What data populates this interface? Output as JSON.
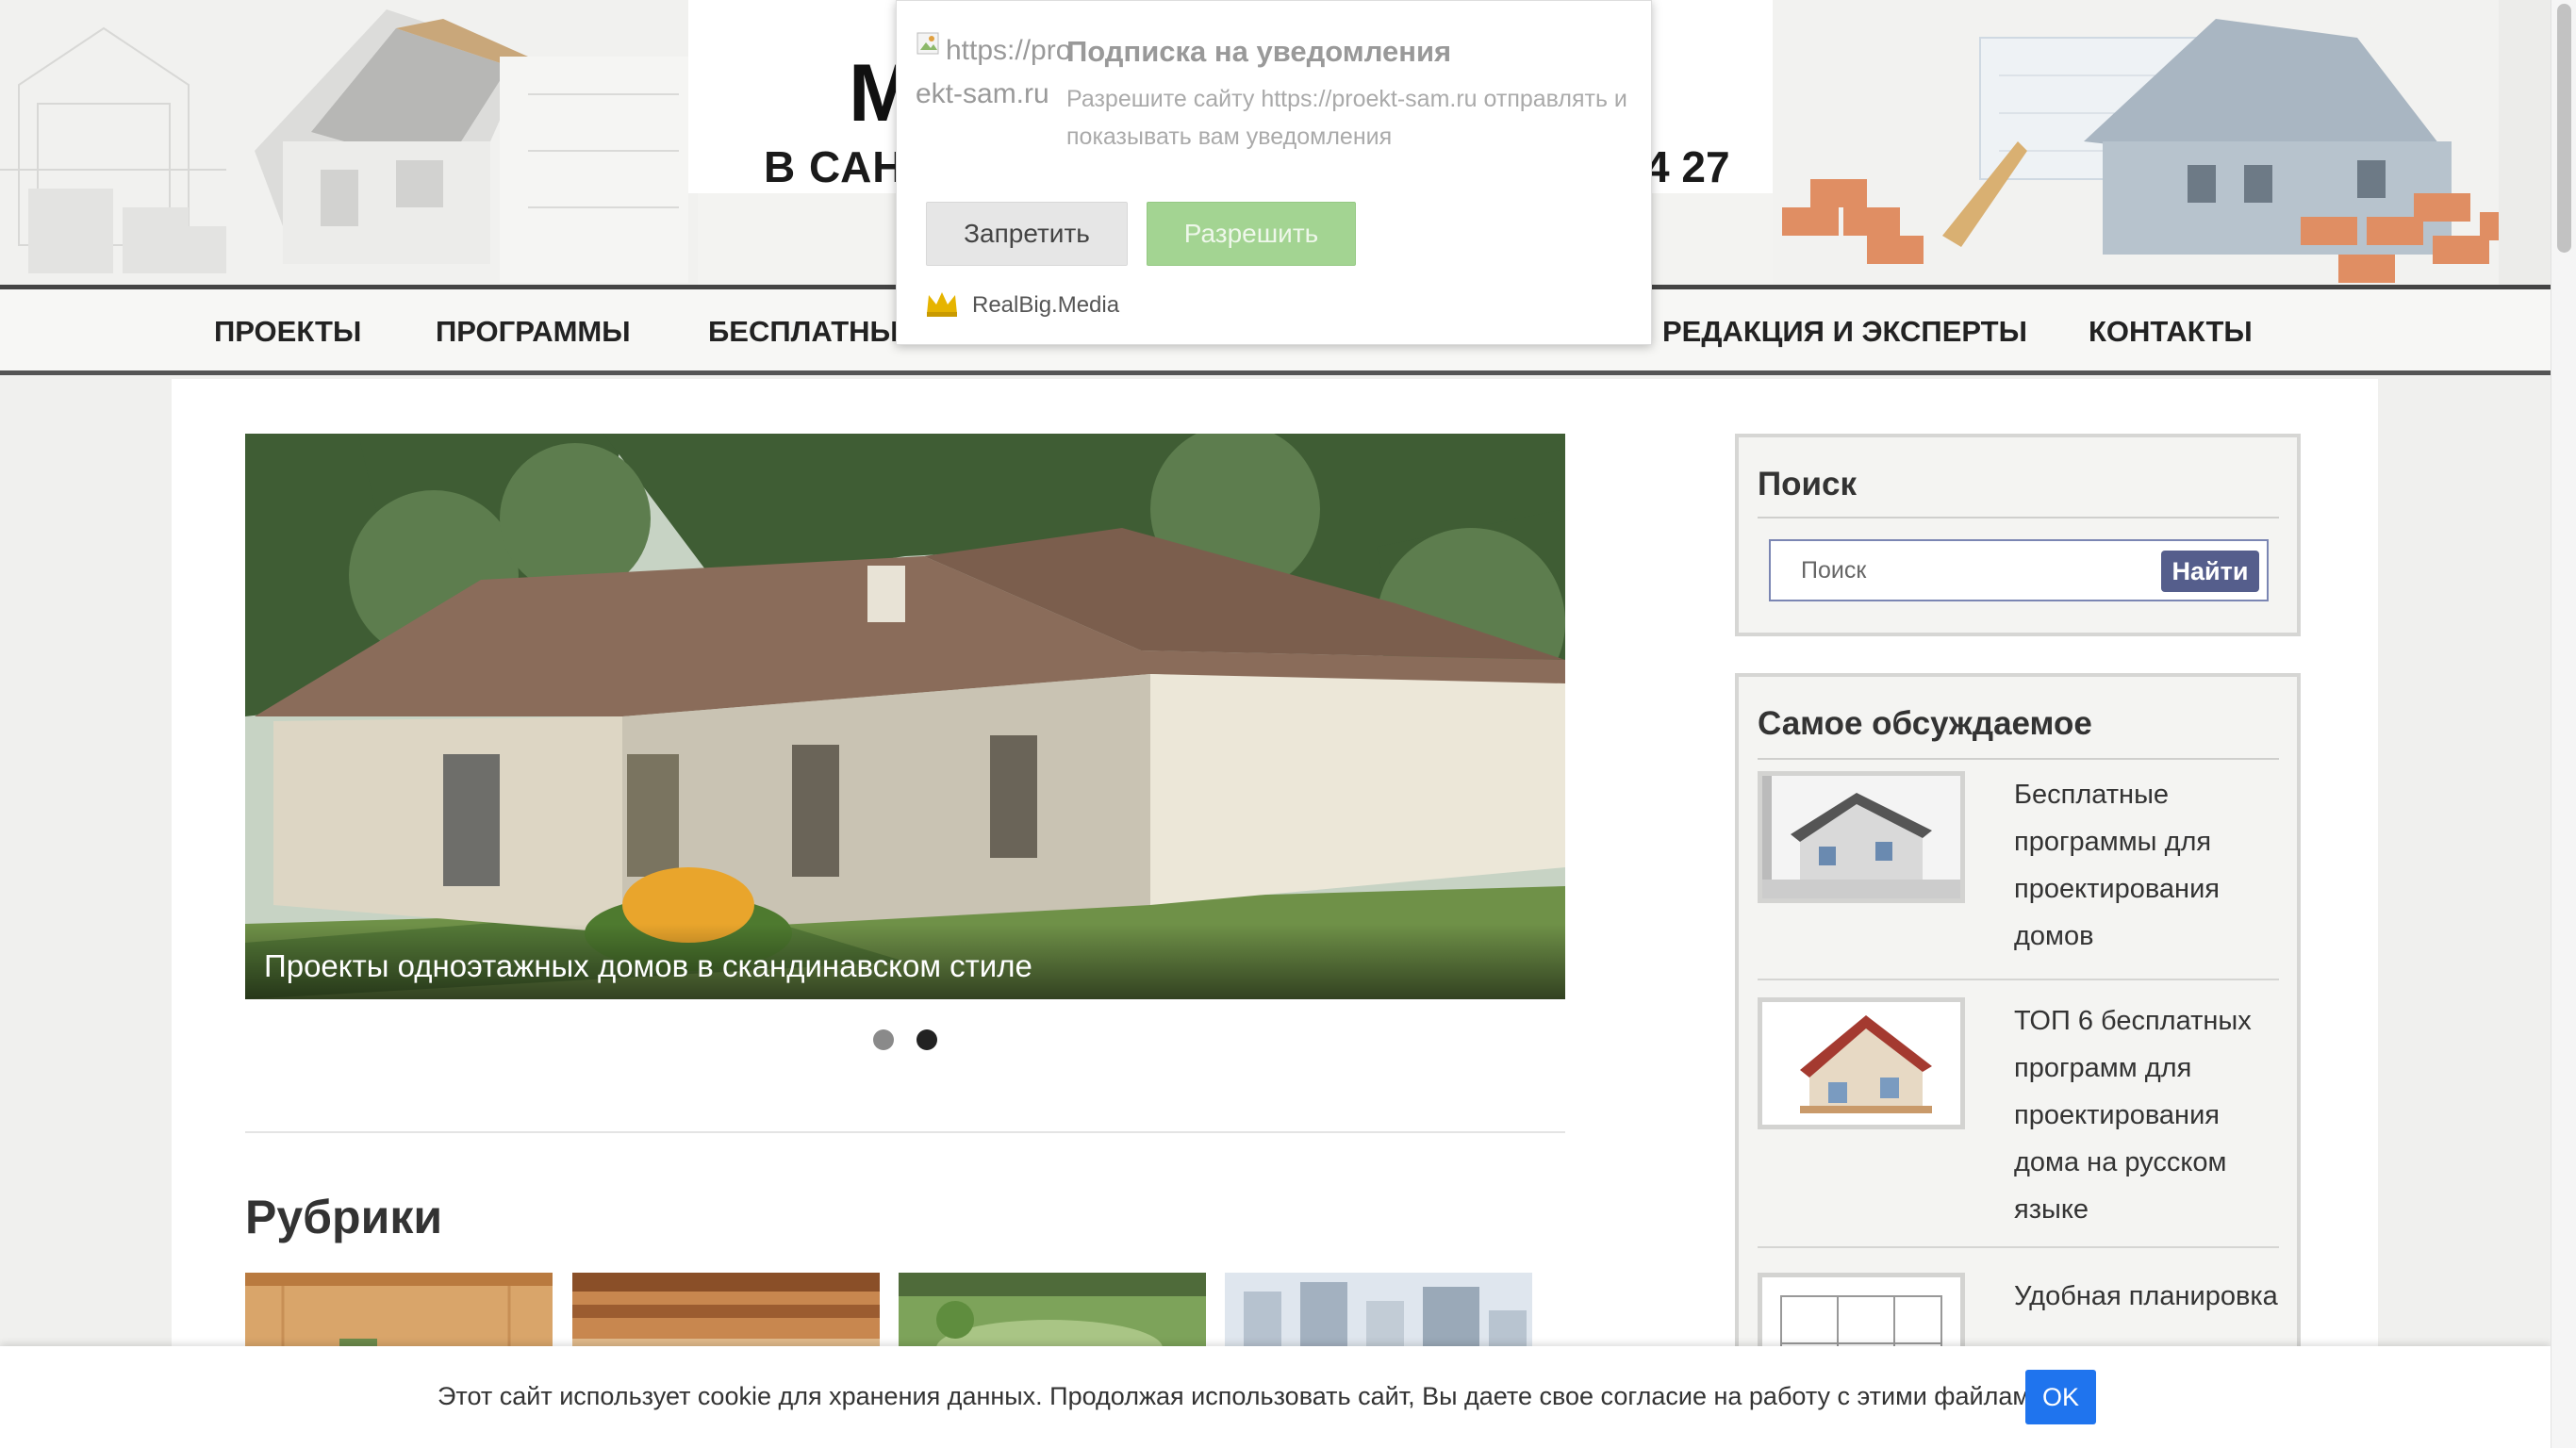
{
  "header": {
    "title_partial": "М",
    "sub_partial": "В САН",
    "phone_partial": "4 27"
  },
  "nav": {
    "items": [
      {
        "label": "ПРОЕКТЫ"
      },
      {
        "label": "ПРОГРАММЫ"
      },
      {
        "label": "БЕСПЛАТНЫЕ"
      },
      {
        "label": "РЕДАКЦИЯ И ЭКСПЕРТЫ"
      },
      {
        "label": "КОНТАКТЫ"
      }
    ]
  },
  "slider": {
    "caption": "Проекты одноэтажных домов в скандинавском стиле",
    "total_slides": 2,
    "active_slide": 2
  },
  "rubrics": {
    "title": "Рубрики"
  },
  "sidebar": {
    "search": {
      "title": "Поиск",
      "placeholder": "Поиск",
      "button_label": "Найти"
    },
    "discussed": {
      "title": "Самое обсуждаемое",
      "items": [
        {
          "text": "Бесплатные программы для проектирования домов"
        },
        {
          "text": "ТОП 6 бесплатных программ для проектирования дома на русском языке"
        },
        {
          "text": "Удобная планировка"
        }
      ]
    }
  },
  "popup": {
    "logo_alt": "https://proekt-sam.ru",
    "title": "Подписка на уведомления",
    "text": "Разрешите сайту https://proekt-sam.ru отправлять и показывать вам уведомления",
    "deny_label": "Запретить",
    "allow_label": "Разрешить",
    "brand": "RealBig.Media"
  },
  "cookie": {
    "text": "Этот сайт использует cookie для хранения данных. Продолжая использовать сайт, Вы даете свое согласие на работу с этими файлами.",
    "ok_label": "OK"
  },
  "colors": {
    "nav_border": "#444444",
    "search_button": "#555e8c",
    "allow_button": "#a3d492",
    "cookie_ok": "#1f74ee",
    "dot_active": "#222222",
    "dot_inactive": "#888888"
  }
}
